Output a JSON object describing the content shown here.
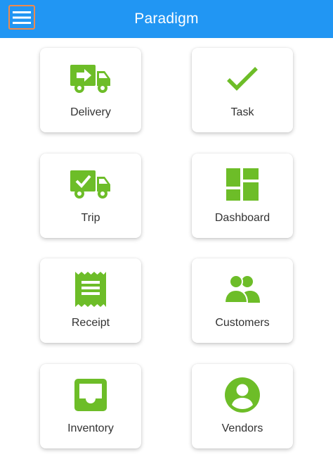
{
  "header": {
    "title": "Paradigm",
    "color": "#2196f3",
    "menu_icon": "menu-icon"
  },
  "accent": "#6dbd28",
  "tiles": [
    {
      "label": "Delivery",
      "icon": "delivery-truck-icon"
    },
    {
      "label": "Task",
      "icon": "checkmark-icon"
    },
    {
      "label": "Trip",
      "icon": "trip-truck-icon"
    },
    {
      "label": "Dashboard",
      "icon": "dashboard-icon"
    },
    {
      "label": "Receipt",
      "icon": "receipt-icon"
    },
    {
      "label": "Customers",
      "icon": "customers-icon"
    },
    {
      "label": "Inventory",
      "icon": "inventory-icon"
    },
    {
      "label": "Vendors",
      "icon": "vendors-icon"
    }
  ]
}
